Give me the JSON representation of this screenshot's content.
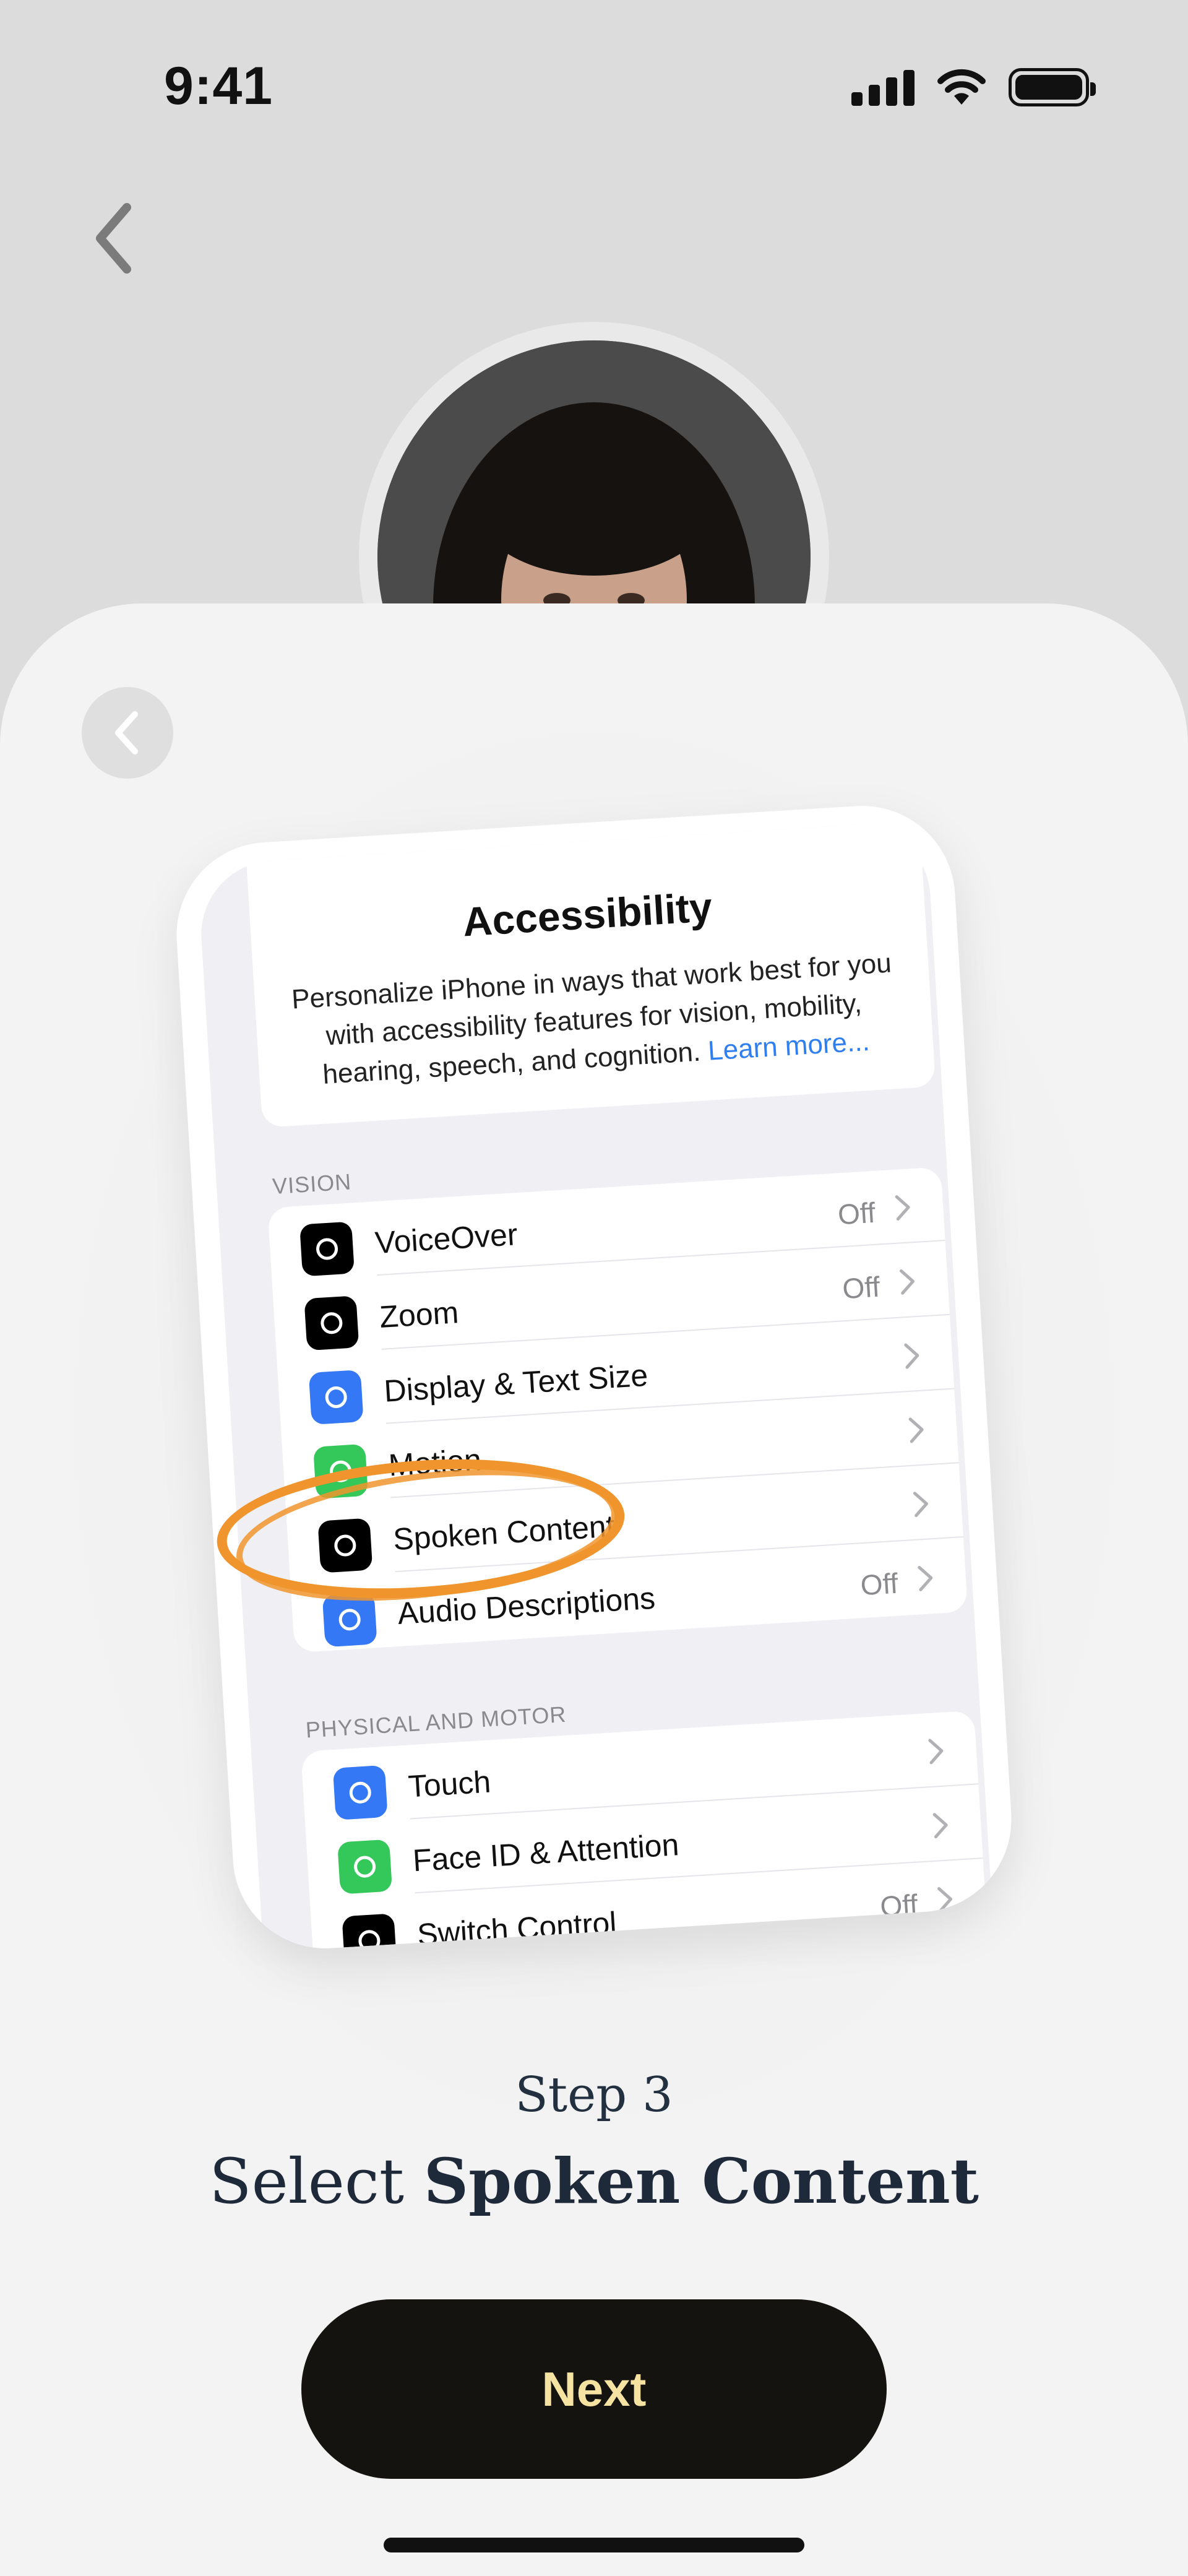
{
  "status_bar": {
    "time": "9:41"
  },
  "screen": {
    "step_label": "Step 3",
    "instruction_prefix": "Select",
    "instruction_emphasis": "Spoken Content",
    "next_button": "Next"
  },
  "illustration": {
    "title": "Accessibility",
    "description": "Personalize iPhone in ways that work best for you with accessibility features for vision, mobility, hearing, speech, and cognition.",
    "learn_more": "Learn more...",
    "vision_header": "VISION",
    "vision_rows": [
      {
        "label": "VoiceOver",
        "value": "Off",
        "icon": "voiceover-icon",
        "color": "#000000"
      },
      {
        "label": "Zoom",
        "value": "Off",
        "icon": "zoom-icon",
        "color": "#000000"
      },
      {
        "label": "Display & Text Size",
        "value": "",
        "icon": "text-size-icon",
        "color": "#3478f6"
      },
      {
        "label": "Motion",
        "value": "",
        "icon": "motion-icon",
        "color": "#34c759"
      },
      {
        "label": "Spoken Content",
        "value": "",
        "icon": "spoken-content-icon",
        "color": "#000000"
      },
      {
        "label": "Audio Descriptions",
        "value": "Off",
        "icon": "audio-descriptions-icon",
        "color": "#3478f6"
      }
    ],
    "physical_header": "PHYSICAL AND MOTOR",
    "physical_rows": [
      {
        "label": "Touch",
        "value": "",
        "icon": "touch-icon",
        "color": "#3478f6"
      },
      {
        "label": "Face ID & Attention",
        "value": "",
        "icon": "face-id-icon",
        "color": "#34c759"
      },
      {
        "label": "Switch Control",
        "value": "Off",
        "icon": "switch-control-icon",
        "color": "#000000"
      }
    ],
    "highlight_color": "#f0952d"
  }
}
